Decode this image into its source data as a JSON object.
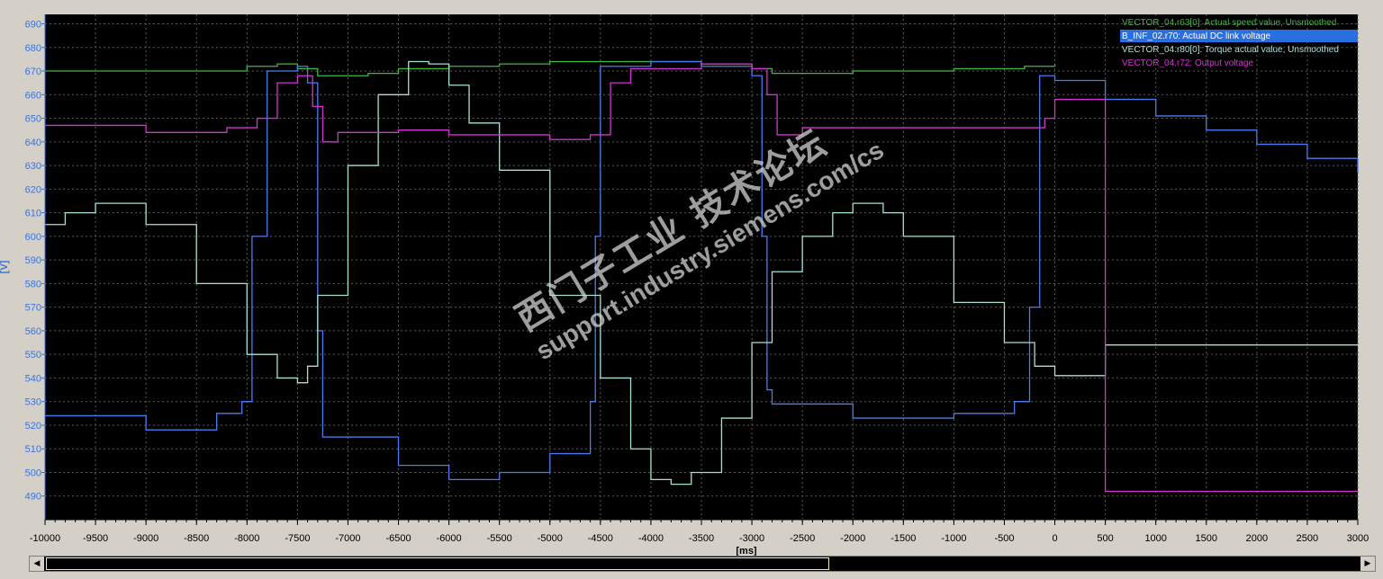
{
  "chart_data": {
    "type": "line",
    "xlabel": "[ms]",
    "ylabel": "[V]",
    "xlim": [
      -10000,
      3000
    ],
    "ylim": [
      480,
      694
    ],
    "xticks": [
      -10000,
      -9500,
      -9000,
      -8500,
      -8000,
      -7500,
      -7000,
      -6500,
      -6000,
      -5500,
      -5000,
      -4500,
      -4000,
      -3500,
      -3000,
      -2500,
      -2000,
      -1500,
      -1000,
      -500,
      0,
      500,
      1000,
      1500,
      2000,
      2500,
      3000
    ],
    "yticks": [
      490,
      500,
      510,
      520,
      530,
      540,
      550,
      560,
      570,
      580,
      590,
      600,
      610,
      620,
      630,
      640,
      650,
      660,
      670,
      680,
      690
    ],
    "grid": true,
    "legend_position": "top-right",
    "series": [
      {
        "name": "VECTOR_04.r63[0]: Actual speed value, Unsmoothed",
        "color": "#3fb83f",
        "x": [
          -10000,
          -8000,
          -7700,
          -7500,
          -7300,
          -6800,
          -6500,
          -6000,
          -5500,
          -5000,
          -4500,
          -3500,
          -3000,
          -2800,
          -2000,
          -1000,
          -300,
          0
        ],
        "y": [
          670,
          672,
          673,
          671,
          668,
          669,
          671,
          672,
          673,
          674,
          674,
          673,
          671,
          669,
          670,
          671,
          672,
          673
        ]
      },
      {
        "name": "B_INF_02.r70: Actual DC link voltage",
        "color": "#4a7cf0",
        "x": [
          -10000,
          -9000,
          -8300,
          -8050,
          -7950,
          -7800,
          -7500,
          -7400,
          -7300,
          -7250,
          -6500,
          -6000,
          -5500,
          -5000,
          -4600,
          -4550,
          -4500,
          -4000,
          -3500,
          -3000,
          -2900,
          -2850,
          -2800,
          -2000,
          -1000,
          -400,
          -250,
          -150,
          0,
          500,
          1000,
          1500,
          2000,
          2500,
          3000
        ],
        "y": [
          524,
          518,
          525,
          530,
          600,
          670,
          672,
          665,
          560,
          515,
          503,
          497,
          500,
          508,
          530,
          600,
          672,
          674,
          672,
          668,
          600,
          535,
          529,
          523,
          525,
          530,
          570,
          668,
          666,
          658,
          651,
          645,
          639,
          633,
          627
        ]
      },
      {
        "name": "VECTOR_04.r80[0]: Torque actual value, Unsmoothed",
        "color": "#a8e0d8",
        "x": [
          -10000,
          -9800,
          -9500,
          -9000,
          -8500,
          -8000,
          -7700,
          -7500,
          -7400,
          -7300,
          -7000,
          -6700,
          -6400,
          -6200,
          -6000,
          -5800,
          -5500,
          -5000,
          -4500,
          -4200,
          -4000,
          -3800,
          -3600,
          -3300,
          -3000,
          -2800,
          -2500,
          -2200,
          -2000,
          -1700,
          -1500,
          -1000,
          -500,
          -200,
          0,
          500,
          1000,
          1500,
          2000,
          2500,
          3000
        ],
        "y": [
          605,
          610,
          614,
          605,
          580,
          550,
          540,
          538,
          545,
          575,
          630,
          660,
          674,
          673,
          664,
          648,
          628,
          575,
          540,
          510,
          497,
          495,
          500,
          523,
          555,
          585,
          600,
          610,
          614,
          610,
          600,
          572,
          555,
          545,
          541,
          554,
          554,
          554,
          554,
          554,
          554
        ]
      },
      {
        "name": "VECTOR_04.r72: Output voltage",
        "color": "#d433d4",
        "x": [
          -10000,
          -9000,
          -8200,
          -7900,
          -7700,
          -7500,
          -7350,
          -7250,
          -7100,
          -6500,
          -6000,
          -5000,
          -4600,
          -4400,
          -4200,
          -3500,
          -3000,
          -2850,
          -2750,
          -2500,
          -2000,
          -1000,
          -300,
          -100,
          0,
          500,
          1000,
          1500,
          2000,
          2500,
          3000
        ],
        "y": [
          647,
          644,
          646,
          650,
          665,
          668,
          655,
          640,
          644,
          645,
          643,
          641,
          643,
          665,
          671,
          673,
          671,
          660,
          643,
          646,
          646,
          646,
          646,
          650,
          658,
          492,
          492,
          492,
          492,
          492,
          492
        ]
      }
    ]
  },
  "watermark": {
    "line1": "西门子工业 技术论坛",
    "line2": "support.industry.siemens.com/cs"
  },
  "scrollbar": {
    "left_arrow": "◀",
    "right_arrow": "▶"
  }
}
